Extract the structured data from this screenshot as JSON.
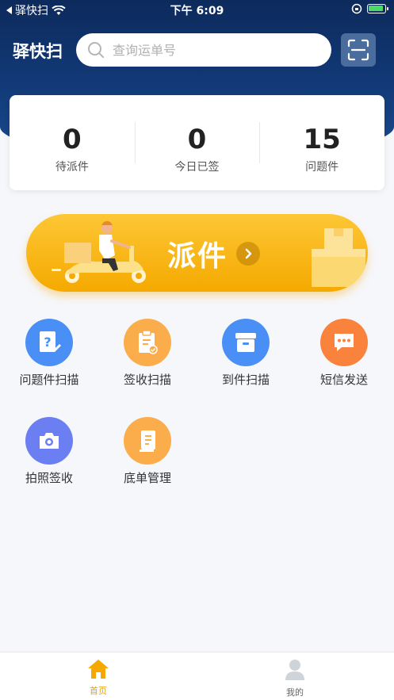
{
  "status_bar": {
    "carrier": "驿快扫",
    "time": "下午 6:09"
  },
  "header": {
    "title": "驿快扫",
    "search_placeholder": "查询运单号"
  },
  "stats": [
    {
      "value": "0",
      "label": "待派件"
    },
    {
      "value": "0",
      "label": "今日已签"
    },
    {
      "value": "15",
      "label": "问题件"
    }
  ],
  "dispatch": {
    "label": "派件"
  },
  "functions": [
    {
      "label": "问题件扫描",
      "icon": "question-doc-icon",
      "color": "#4a8ff5"
    },
    {
      "label": "签收扫描",
      "icon": "clipboard-check-icon",
      "color": "#fcad4b"
    },
    {
      "label": "到件扫描",
      "icon": "package-box-icon",
      "color": "#4a8ff5"
    },
    {
      "label": "短信发送",
      "icon": "message-bubble-icon",
      "color": "#f9823c"
    },
    {
      "label": "拍照签收",
      "icon": "camera-icon",
      "color": "#6b7ff2"
    },
    {
      "label": "底单管理",
      "icon": "receipt-doc-icon",
      "color": "#fcad4b"
    }
  ],
  "tabs": [
    {
      "label": "首页",
      "icon": "home-icon",
      "active": true
    },
    {
      "label": "我的",
      "icon": "user-icon",
      "active": false
    }
  ],
  "colors": {
    "header_dark": "#0d2a5c",
    "accent_yellow": "#f5a900",
    "tab_active": "#e8a300",
    "tab_inactive": "#666666"
  }
}
